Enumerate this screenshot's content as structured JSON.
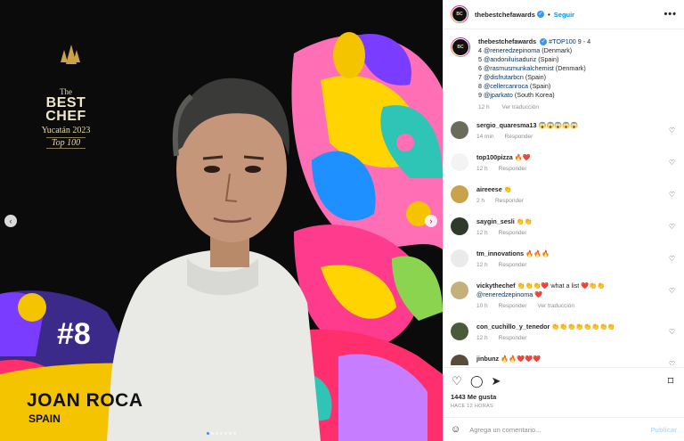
{
  "post_image": {
    "logo": {
      "line1": "The",
      "line2a": "BEST",
      "line2b": "CHEF",
      "line3": "Yucatán 2023",
      "line4": "Top 100"
    },
    "rank": "#8",
    "chef_name": "JOAN ROCA",
    "chef_country": "SPAIN"
  },
  "header": {
    "username": "thebestchefawards",
    "separator": "•",
    "follow_label": "Seguir",
    "more_label": "•••"
  },
  "caption": {
    "username": "thebestchefawards",
    "hashtag": "#TOP100",
    "range": "9 - 4",
    "lines": [
      {
        "num": "4",
        "handle": "@reneredzepinoma",
        "country": "(Denmark)"
      },
      {
        "num": "5",
        "handle": "@andoniluisaduriz",
        "country": "(Spain)"
      },
      {
        "num": "6",
        "handle": "@rasmusmunkalchemist",
        "country": "(Denmark)"
      },
      {
        "num": "7",
        "handle": "@disfrutarbcn",
        "country": "(Spain)"
      },
      {
        "num": "8",
        "handle": "@cellercanroca",
        "country": "(Spain)"
      },
      {
        "num": "9",
        "handle": "@jparkato",
        "country": "(South Korea)"
      }
    ],
    "time": "12 h",
    "translate": "Ver traducción"
  },
  "comments": [
    {
      "username": "sergio_quaresma13",
      "text": "😱😱😱😱😱",
      "time": "14 min",
      "reply": "Responder",
      "avatar_color": "#6b6b5a"
    },
    {
      "username": "top100pizza",
      "text": "🔥❤️",
      "time": "12 h",
      "reply": "Responder",
      "avatar_color": "#f3f3f3"
    },
    {
      "username": "aireeese",
      "text": "👏",
      "time": "2 h",
      "reply": "Responder",
      "avatar_color": "#c9a24a"
    },
    {
      "username": "saygin_sesli",
      "text": "👏👏",
      "time": "12 h",
      "reply": "Responder",
      "avatar_color": "#2f3a2a"
    },
    {
      "username": "tm_innovations",
      "text": "🔥🔥🔥",
      "time": "12 h",
      "reply": "Responder",
      "avatar_color": "#eaeaea"
    },
    {
      "username": "vickythechef",
      "text": "👏👏👏❤️ what a list ❤️👏👏",
      "mention": "@reneredzepinoma",
      "mention_suffix": "❤️",
      "time": "10 h",
      "reply": "Responder",
      "translate": "Ver traducción",
      "avatar_color": "#c4b07a"
    },
    {
      "username": "con_cuchillo_y_tenedor",
      "text": "👏👏👏👏👏👏👏👏",
      "time": "12 h",
      "reply": "Responder",
      "avatar_color": "#4a5a3a"
    },
    {
      "username": "jinbunz",
      "text": "🔥🔥❤️❤️❤️",
      "time": "",
      "reply": "",
      "avatar_color": "#5a4a3a"
    }
  ],
  "likes": "1443 Me gusta",
  "date": "HACE 12 HORAS",
  "add_comment_placeholder": "Agrega un comentario...",
  "publish_label": "Publicar",
  "colors": {
    "accent": "#0095f6",
    "verified": "#3897f0",
    "rank_bg": "#3b2a8a",
    "name_bg": "#f5c400"
  }
}
